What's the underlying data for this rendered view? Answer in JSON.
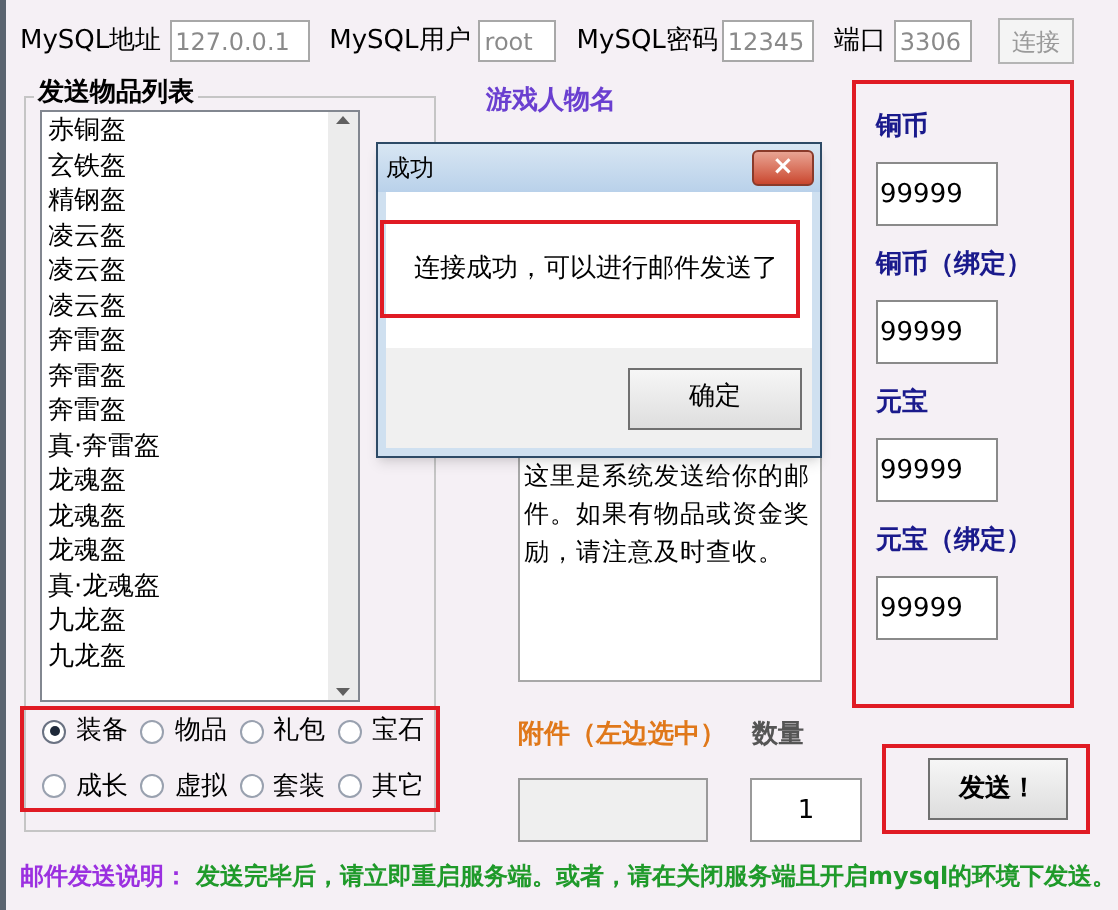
{
  "connection": {
    "fields": [
      {
        "label": "MySQL地址",
        "value": "127.0.0.1"
      },
      {
        "label": "MySQL用户",
        "value": "root"
      },
      {
        "label": "MySQL密码",
        "value": "12345"
      },
      {
        "label": "端口",
        "value": "3306"
      }
    ],
    "connect_button": {
      "label": "连接",
      "disabled": true
    }
  },
  "item_list": {
    "title": "发送物品列表",
    "items": [
      "赤铜盔",
      "玄铁盔",
      "精钢盔",
      "凌云盔",
      "凌云盔",
      "凌云盔",
      "奔雷盔",
      "奔雷盔",
      "奔雷盔",
      "真·奔雷盔",
      "龙魂盔",
      "龙魂盔",
      "龙魂盔",
      "真·龙魂盔",
      "九龙盔",
      "九龙盔"
    ],
    "categories": [
      {
        "label": "装备",
        "selected": true
      },
      {
        "label": "物品",
        "selected": false
      },
      {
        "label": "礼包",
        "selected": false
      },
      {
        "label": "宝石",
        "selected": false
      },
      {
        "label": "成长",
        "selected": false
      },
      {
        "label": "虚拟",
        "selected": false
      },
      {
        "label": "套装",
        "selected": false
      },
      {
        "label": "其它",
        "selected": false
      }
    ]
  },
  "player_name_label": "游戏人物名",
  "mail_body": "这里是系统发送给你的邮件。如果有物品或资金奖励，请注意及时查收。",
  "currencies": [
    {
      "label": "铜币",
      "value": "99999"
    },
    {
      "label": "铜币（绑定）",
      "value": "99999"
    },
    {
      "label": "元宝",
      "value": "99999"
    },
    {
      "label": "元宝（绑定）",
      "value": "99999"
    }
  ],
  "attachment": {
    "label": "附件（左边选中）"
  },
  "quantity": {
    "label": "数量",
    "value": "1"
  },
  "send_button": "发送！",
  "note": {
    "label": "邮件发送说明：",
    "text": "发送完毕后，请立即重启服务端。或者，请在关闭服务端且开启mysql的环境下发送。"
  },
  "dialog": {
    "title": "成功",
    "close": "×",
    "message": "连接成功，可以进行邮件发送了",
    "ok_button": "确定"
  }
}
